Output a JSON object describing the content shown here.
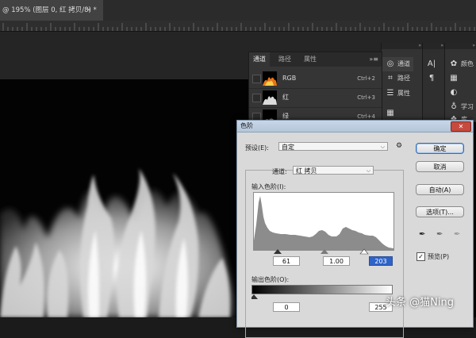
{
  "document_tab": {
    "title": "@ 195% (图层 0, 红 拷贝/8) *",
    "close_glyph": "×"
  },
  "channels_panel": {
    "tabs": [
      {
        "label": "通道",
        "active": true
      },
      {
        "label": "路径",
        "active": false
      },
      {
        "label": "属性",
        "active": false
      }
    ],
    "menu_glyph": "»≡",
    "rows": [
      {
        "name": "RGB",
        "shortcut": "Ctrl+2"
      },
      {
        "name": "红",
        "shortcut": "Ctrl+3"
      },
      {
        "name": "绿",
        "shortcut": "Ctrl+4"
      }
    ]
  },
  "panel_strip_a": {
    "header": "»",
    "items": [
      {
        "label": "通道",
        "icon": "channels-icon",
        "active": true
      },
      {
        "label": "路径",
        "icon": "paths-icon",
        "active": false
      },
      {
        "label": "属性",
        "icon": "properties-icon",
        "active": false
      }
    ]
  },
  "panel_strip_b": {
    "header": "»",
    "icons": [
      "character-icon",
      "paragraph-icon"
    ]
  },
  "panel_strip_c": {
    "header": "»",
    "items": [
      {
        "label": "颜色",
        "icon": "color-palette-icon"
      },
      {
        "label": "",
        "icon": "grid-swatches-icon"
      },
      {
        "label": "",
        "icon": "adjustments-icon"
      },
      {
        "label": "学习",
        "icon": "learn-bulb-icon"
      },
      {
        "label": "库",
        "icon": "libraries-icon"
      }
    ]
  },
  "levels_dialog": {
    "title": "色阶",
    "close_glyph": "✕",
    "preset_label": "预设(E):",
    "preset_value": "自定",
    "channel_label": "通道:",
    "channel_value": "红 拷贝",
    "input_levels_label": "输入色阶(I):",
    "input_black": "61",
    "input_gamma": "1.00",
    "input_white": "203",
    "output_levels_label": "输出色阶(O):",
    "output_black": "0",
    "output_white": "255",
    "buttons": {
      "ok": "确定",
      "cancel": "取消",
      "auto": "自动(A)",
      "options": "选项(T)..."
    },
    "preview_label": "预览(P)",
    "preview_checked": true
  },
  "watermark": "头条 @猫Ning",
  "colors": {
    "dialog_bg": "#d9d9d9",
    "canvas_bg": "#030303",
    "panel_bg": "#353535",
    "close_red": "#c64a3e",
    "selected_field": "#2f63c8"
  }
}
